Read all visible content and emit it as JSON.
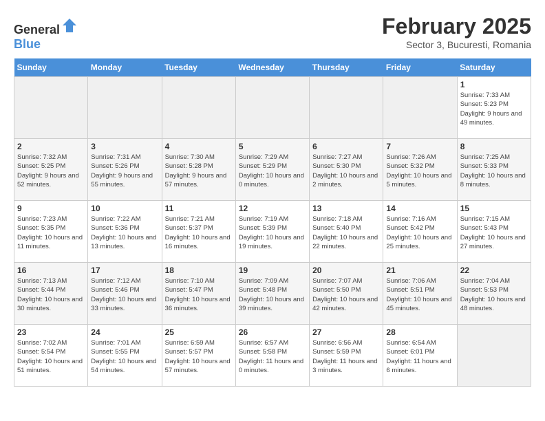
{
  "logo": {
    "general": "General",
    "blue": "Blue"
  },
  "title": "February 2025",
  "subtitle": "Sector 3, Bucuresti, Romania",
  "headers": [
    "Sunday",
    "Monday",
    "Tuesday",
    "Wednesday",
    "Thursday",
    "Friday",
    "Saturday"
  ],
  "weeks": [
    [
      {
        "day": "",
        "info": ""
      },
      {
        "day": "",
        "info": ""
      },
      {
        "day": "",
        "info": ""
      },
      {
        "day": "",
        "info": ""
      },
      {
        "day": "",
        "info": ""
      },
      {
        "day": "",
        "info": ""
      },
      {
        "day": "1",
        "info": "Sunrise: 7:33 AM\nSunset: 5:23 PM\nDaylight: 9 hours and 49 minutes."
      }
    ],
    [
      {
        "day": "2",
        "info": "Sunrise: 7:32 AM\nSunset: 5:25 PM\nDaylight: 9 hours and 52 minutes."
      },
      {
        "day": "3",
        "info": "Sunrise: 7:31 AM\nSunset: 5:26 PM\nDaylight: 9 hours and 55 minutes."
      },
      {
        "day": "4",
        "info": "Sunrise: 7:30 AM\nSunset: 5:28 PM\nDaylight: 9 hours and 57 minutes."
      },
      {
        "day": "5",
        "info": "Sunrise: 7:29 AM\nSunset: 5:29 PM\nDaylight: 10 hours and 0 minutes."
      },
      {
        "day": "6",
        "info": "Sunrise: 7:27 AM\nSunset: 5:30 PM\nDaylight: 10 hours and 2 minutes."
      },
      {
        "day": "7",
        "info": "Sunrise: 7:26 AM\nSunset: 5:32 PM\nDaylight: 10 hours and 5 minutes."
      },
      {
        "day": "8",
        "info": "Sunrise: 7:25 AM\nSunset: 5:33 PM\nDaylight: 10 hours and 8 minutes."
      }
    ],
    [
      {
        "day": "9",
        "info": "Sunrise: 7:23 AM\nSunset: 5:35 PM\nDaylight: 10 hours and 11 minutes."
      },
      {
        "day": "10",
        "info": "Sunrise: 7:22 AM\nSunset: 5:36 PM\nDaylight: 10 hours and 13 minutes."
      },
      {
        "day": "11",
        "info": "Sunrise: 7:21 AM\nSunset: 5:37 PM\nDaylight: 10 hours and 16 minutes."
      },
      {
        "day": "12",
        "info": "Sunrise: 7:19 AM\nSunset: 5:39 PM\nDaylight: 10 hours and 19 minutes."
      },
      {
        "day": "13",
        "info": "Sunrise: 7:18 AM\nSunset: 5:40 PM\nDaylight: 10 hours and 22 minutes."
      },
      {
        "day": "14",
        "info": "Sunrise: 7:16 AM\nSunset: 5:42 PM\nDaylight: 10 hours and 25 minutes."
      },
      {
        "day": "15",
        "info": "Sunrise: 7:15 AM\nSunset: 5:43 PM\nDaylight: 10 hours and 27 minutes."
      }
    ],
    [
      {
        "day": "16",
        "info": "Sunrise: 7:13 AM\nSunset: 5:44 PM\nDaylight: 10 hours and 30 minutes."
      },
      {
        "day": "17",
        "info": "Sunrise: 7:12 AM\nSunset: 5:46 PM\nDaylight: 10 hours and 33 minutes."
      },
      {
        "day": "18",
        "info": "Sunrise: 7:10 AM\nSunset: 5:47 PM\nDaylight: 10 hours and 36 minutes."
      },
      {
        "day": "19",
        "info": "Sunrise: 7:09 AM\nSunset: 5:48 PM\nDaylight: 10 hours and 39 minutes."
      },
      {
        "day": "20",
        "info": "Sunrise: 7:07 AM\nSunset: 5:50 PM\nDaylight: 10 hours and 42 minutes."
      },
      {
        "day": "21",
        "info": "Sunrise: 7:06 AM\nSunset: 5:51 PM\nDaylight: 10 hours and 45 minutes."
      },
      {
        "day": "22",
        "info": "Sunrise: 7:04 AM\nSunset: 5:53 PM\nDaylight: 10 hours and 48 minutes."
      }
    ],
    [
      {
        "day": "23",
        "info": "Sunrise: 7:02 AM\nSunset: 5:54 PM\nDaylight: 10 hours and 51 minutes."
      },
      {
        "day": "24",
        "info": "Sunrise: 7:01 AM\nSunset: 5:55 PM\nDaylight: 10 hours and 54 minutes."
      },
      {
        "day": "25",
        "info": "Sunrise: 6:59 AM\nSunset: 5:57 PM\nDaylight: 10 hours and 57 minutes."
      },
      {
        "day": "26",
        "info": "Sunrise: 6:57 AM\nSunset: 5:58 PM\nDaylight: 11 hours and 0 minutes."
      },
      {
        "day": "27",
        "info": "Sunrise: 6:56 AM\nSunset: 5:59 PM\nDaylight: 11 hours and 3 minutes."
      },
      {
        "day": "28",
        "info": "Sunrise: 6:54 AM\nSunset: 6:01 PM\nDaylight: 11 hours and 6 minutes."
      },
      {
        "day": "",
        "info": ""
      }
    ]
  ]
}
